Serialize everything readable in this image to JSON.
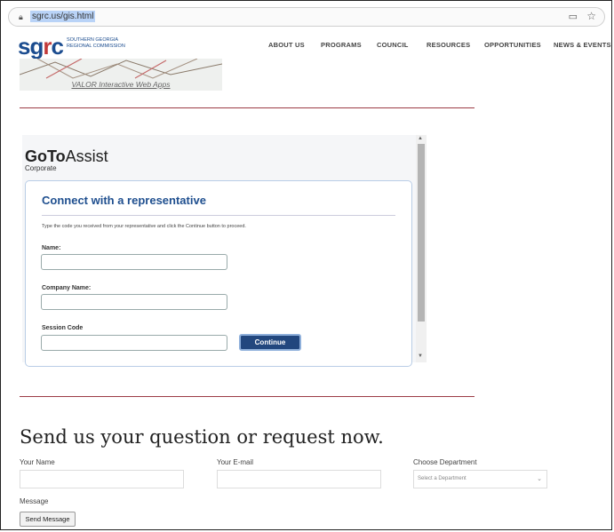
{
  "browser": {
    "url": "sgrc.us/gis.html"
  },
  "site": {
    "logo_mark_left": "sg",
    "logo_mark_r": "r",
    "logo_mark_right": "c",
    "logo_text": "SOUTHERN GEORGIA REGIONAL COMMISSION",
    "nav": [
      "ABOUT US",
      "PROGRAMS",
      "COUNCIL",
      "RESOURCES",
      "OPPORTUNITIES",
      "NEWS & EVENTS"
    ]
  },
  "valor": {
    "caption": "VALOR Interactive Web Apps"
  },
  "gotoassist": {
    "brand_bold": "GoTo",
    "brand_light": "Assist",
    "brand_sub": "Corporate",
    "title": "Connect with a representative",
    "instructions": "Type the code you received from your representative and click the Continue button to proceed.",
    "name_label": "Name:",
    "company_label": "Company Name:",
    "session_label": "Session Code",
    "continue_label": "Continue"
  },
  "contact": {
    "heading": "Send us your question or request now.",
    "name_label": "Your Name",
    "email_label": "Your E-mail",
    "department_label": "Choose Department",
    "department_value": "Select a Department",
    "message_label": "Message",
    "send_label": "Send Message"
  },
  "colors": {
    "brand_blue": "#1b4c8f",
    "brand_red": "#c23a3a",
    "divider": "#9c3b45",
    "button_navy": "#22477e"
  }
}
